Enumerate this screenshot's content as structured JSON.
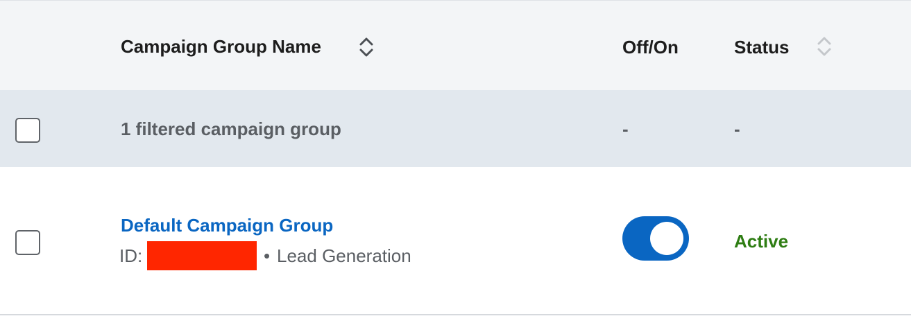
{
  "header": {
    "col_name": "Campaign Group Name",
    "col_toggle": "Off/On",
    "col_status": "Status"
  },
  "summary": {
    "label": "1 filtered campaign group",
    "toggle_value": "-",
    "status_value": "-"
  },
  "rows": [
    {
      "name": "Default Campaign Group",
      "id_label": "ID:",
      "separator": "•",
      "objective": "Lead Generation",
      "toggle_on": true,
      "status": "Active"
    }
  ],
  "colors": {
    "header_bg": "#f3f5f7",
    "summary_bg": "#e2e8ee",
    "link": "#0a66c2",
    "toggle_on": "#0a66c2",
    "status_active": "#2e7d13",
    "redaction": "#ff2600"
  },
  "icons": {
    "sort_name": "sort-icon",
    "sort_status": "sort-icon-disabled"
  }
}
